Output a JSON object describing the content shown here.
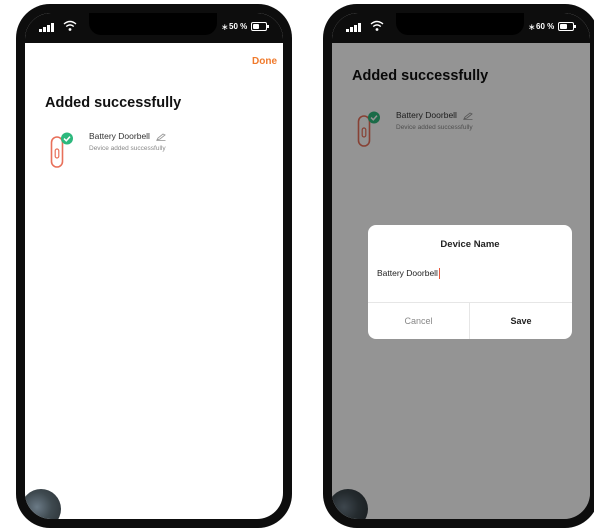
{
  "left_screen": {
    "status": {
      "battery": "50 %",
      "battery_level": 0.5
    },
    "done_label": "Done",
    "title": "Added successfully",
    "device": {
      "name": "Battery Doorbell",
      "status": "Device added successfully"
    }
  },
  "right_screen": {
    "status": {
      "battery": "60 %",
      "battery_level": 0.6
    },
    "title": "Added successfully",
    "device": {
      "name": "Battery Doorbell",
      "status": "Device added successfully"
    },
    "dialog": {
      "title": "Device Name",
      "input_value": "Battery Doorbell",
      "cancel_label": "Cancel",
      "save_label": "Save"
    }
  },
  "colors": {
    "accent": "#f07a2c",
    "success": "#2db87d",
    "device_icon": "#e8705a"
  }
}
